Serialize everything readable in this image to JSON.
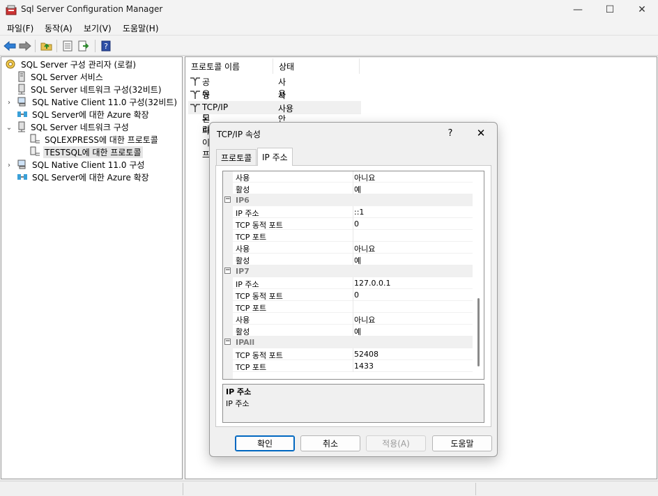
{
  "window": {
    "title": "Sql Server Configuration Manager"
  },
  "menu": [
    "파일(F)",
    "동작(A)",
    "보기(V)",
    "도움말(H)"
  ],
  "toolbar_icons": [
    "back-arrow-icon",
    "forward-arrow-icon",
    "up-folder-icon",
    "properties-icon",
    "export-icon",
    "help-icon"
  ],
  "tree": {
    "root": "SQL Server 구성 관리자 (로컬)",
    "items": [
      "SQL Server 서비스",
      "SQL Server 네트워크 구성(32비트)",
      "SQL Native Client 11.0 구성(32비트)",
      "SQL Server에 대한 Azure 확장",
      "SQL Server 네트워크 구성",
      "SQLEXPRESS에 대한 프로토콜",
      "TESTSQL에 대한 프로토콜",
      "SQL Native Client 11.0 구성",
      "SQL Server에 대한 Azure 확장"
    ]
  },
  "list": {
    "headers": [
      "프로토콜 이름",
      "상태"
    ],
    "rows": [
      {
        "name": "공유 메모리",
        "status": "사용"
      },
      {
        "name": "명명된 파이프",
        "status": "사용 안 함"
      },
      {
        "name": "TCP/IP",
        "status": "사용"
      }
    ]
  },
  "dialog": {
    "title": "TCP/IP 속성",
    "help": "?",
    "close": "✕",
    "tabs": [
      "프로토콜",
      "IP 주소"
    ],
    "grid": {
      "top_rows": [
        {
          "label": "사용",
          "value": "아니요"
        },
        {
          "label": "활성",
          "value": "예"
        }
      ],
      "ip6": {
        "name": "IP6",
        "rows": [
          {
            "label": "IP 주소",
            "value": "::1"
          },
          {
            "label": "TCP 동적 포트",
            "value": "0"
          },
          {
            "label": "TCP 포트",
            "value": ""
          },
          {
            "label": "사용",
            "value": "아니요"
          },
          {
            "label": "활성",
            "value": "예"
          }
        ]
      },
      "ip7": {
        "name": "IP7",
        "rows": [
          {
            "label": "IP 주소",
            "value": "127.0.0.1"
          },
          {
            "label": "TCP 동적 포트",
            "value": "0"
          },
          {
            "label": "TCP 포트",
            "value": ""
          },
          {
            "label": "사용",
            "value": "아니요"
          },
          {
            "label": "활성",
            "value": "예"
          }
        ]
      },
      "ipall": {
        "name": "IPAll",
        "rows": [
          {
            "label": "TCP 동적 포트",
            "value": "52408"
          },
          {
            "label": "TCP 포트",
            "value": "1433"
          }
        ]
      }
    },
    "description": {
      "title": "IP 주소",
      "text": "IP 주소"
    },
    "buttons": {
      "ok": "확인",
      "cancel": "취소",
      "apply": "적용(A)",
      "help": "도움말"
    }
  }
}
